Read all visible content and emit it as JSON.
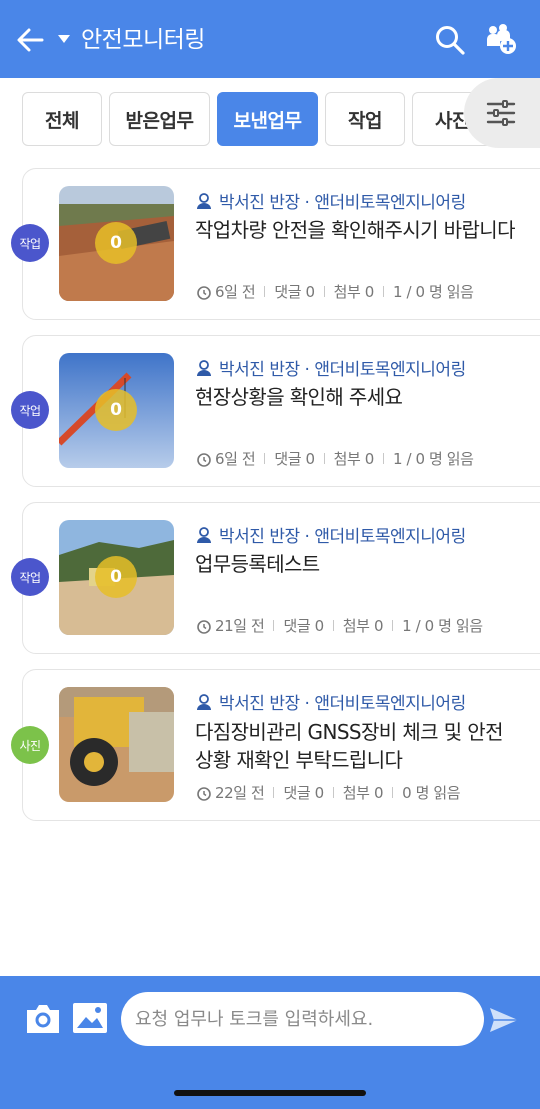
{
  "header": {
    "title": "안전모니터링"
  },
  "tabs": [
    {
      "label": "전체"
    },
    {
      "label": "받은업무"
    },
    {
      "label": "보낸업무"
    },
    {
      "label": "작업"
    },
    {
      "label": "사진"
    }
  ],
  "active_tab": "보낸업무",
  "posts": [
    {
      "type": "작업",
      "badge_color": "#4b56cc",
      "image_count": "0",
      "author": "박서진 반장 · 앤더비토목엔지니어링",
      "title": "작업차량 안전을 확인해주시기 바랍니다",
      "time": "6일 전",
      "comments": "댓글 0",
      "attachments": "첨부 0",
      "read": "1 / 0 명 읽음"
    },
    {
      "type": "작업",
      "badge_color": "#4b56cc",
      "image_count": "0",
      "author": "박서진 반장 · 앤더비토목엔지니어링",
      "title": "현장상황을 확인해 주세요",
      "time": "6일 전",
      "comments": "댓글 0",
      "attachments": "첨부 0",
      "read": "1 / 0 명 읽음"
    },
    {
      "type": "작업",
      "badge_color": "#4b56cc",
      "image_count": "0",
      "author": "박서진 반장 · 앤더비토목엔지니어링",
      "title": "업무등록테스트",
      "time": "21일 전",
      "comments": "댓글 0",
      "attachments": "첨부 0",
      "read": "1 / 0 명 읽음"
    },
    {
      "type": "사진",
      "badge_color": "#7cc24a",
      "image_count": "",
      "author": "박서진 반장 · 앤더비토목엔지니어링",
      "title": "다짐장비관리 GNSS장비 체크 및 안전상황 재확인 부탁드립니다",
      "time": "22일 전",
      "comments": "댓글 0",
      "attachments": "첨부 0",
      "read": "0 명 읽음"
    }
  ],
  "composer": {
    "placeholder": "요청 업무나 토크를 입력하세요."
  },
  "colors": {
    "primary": "#4a86e8",
    "author_text": "#2f5aa8",
    "work_badge": "#4b56cc",
    "photo_badge": "#7cc24a"
  },
  "icons": [
    "back-arrow-icon",
    "dropdown-caret-icon",
    "search-icon",
    "people-add-icon",
    "filter-sliders-icon",
    "user-icon",
    "clock-icon",
    "camera-icon",
    "image-icon",
    "send-icon"
  ]
}
